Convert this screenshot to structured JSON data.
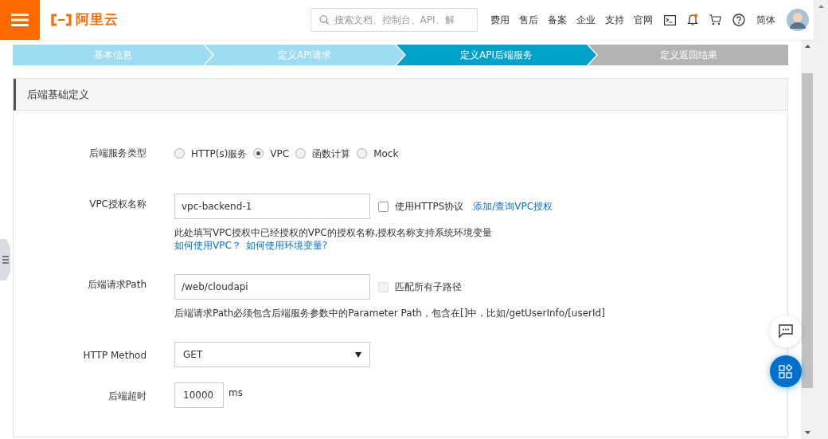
{
  "header": {
    "logo_text": "阿里云",
    "search": {
      "placeholder": "搜索文档、控制台、API、解"
    },
    "nav_links": [
      "费用",
      "售后",
      "备案",
      "企业",
      "支持",
      "官网"
    ],
    "notification": true,
    "language": "简体"
  },
  "steps": [
    {
      "label": "基本信息",
      "selected": false
    },
    {
      "label": "定义API请求",
      "selected": false
    },
    {
      "label": "定义API后端服务",
      "selected": true
    },
    {
      "label": "定义返回结果",
      "selected": false
    }
  ],
  "section": {
    "title": "后端基础定义"
  },
  "fields": [
    {
      "kind": "radio",
      "label": "后端服务类型",
      "options": [
        {
          "label": "HTTP(s)服务",
          "selected": false
        },
        {
          "label": "VPC",
          "selected": true
        },
        {
          "label": "函数计算",
          "selected": false
        },
        {
          "label": "Mock",
          "selected": false
        }
      ]
    },
    {
      "kind": "text",
      "label": "VPC授权名称",
      "value": "vpc-backend-1",
      "checkbox": {
        "label": "使用HTTPS协议",
        "checked": false,
        "disabled": false
      },
      "link": "添加/查询VPC授权",
      "help": "此处填写VPC授权中已经授权的VPC的授权名称,授权名称支持系统环境变量",
      "help_links": [
        "如何使用VPC？",
        "如何使用环境变量?"
      ]
    },
    {
      "kind": "text",
      "label": "后端请求Path",
      "value": "/web/cloudapi",
      "checkbox": {
        "label": "匹配所有子路径",
        "checked": false,
        "disabled": true
      },
      "help": "后端请求Path必须包含后端服务参数中的Parameter Path，包含在[]中，比如/getUserInfo/[userId]"
    },
    {
      "kind": "select",
      "label": "HTTP Method",
      "value": "GET"
    },
    {
      "kind": "unit",
      "label": "后端超时",
      "value": "10000",
      "unit": "ms"
    }
  ]
}
